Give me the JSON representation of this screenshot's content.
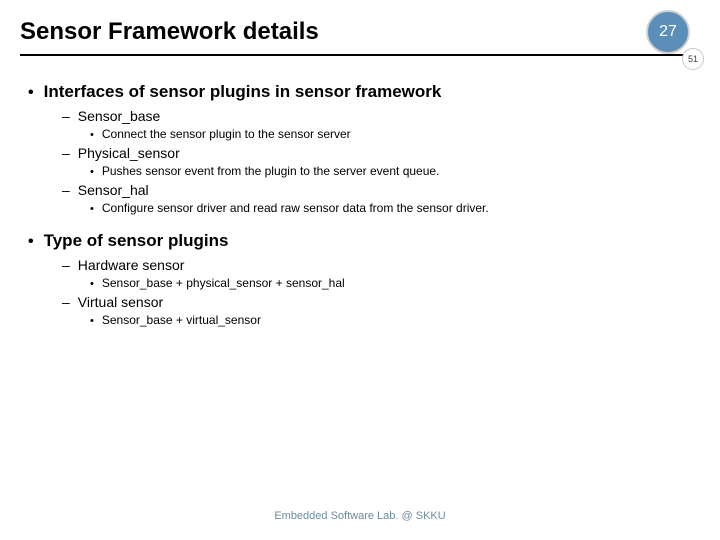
{
  "header": {
    "title": "Sensor Framework details",
    "badge_main": "27",
    "badge_small": "51"
  },
  "sections": [
    {
      "head": "Interfaces of sensor plugins in sensor framework",
      "items": [
        {
          "head": "Sensor_base",
          "sub": [
            "Connect the sensor plugin to the sensor server"
          ]
        },
        {
          "head": "Physical_sensor",
          "sub": [
            "Pushes sensor event from the plugin to the server event queue."
          ]
        },
        {
          "head": "Sensor_hal",
          "sub": [
            "Configure sensor driver and read raw sensor data from the sensor driver."
          ]
        }
      ]
    },
    {
      "head": "Type of sensor plugins",
      "items": [
        {
          "head": "Hardware sensor",
          "sub": [
            "Sensor_base + physical_sensor + sensor_hal"
          ]
        },
        {
          "head": "Virtual sensor",
          "sub": [
            "Sensor_base + virtual_sensor"
          ]
        }
      ]
    }
  ],
  "footer": "Embedded Software Lab. @ SKKU"
}
